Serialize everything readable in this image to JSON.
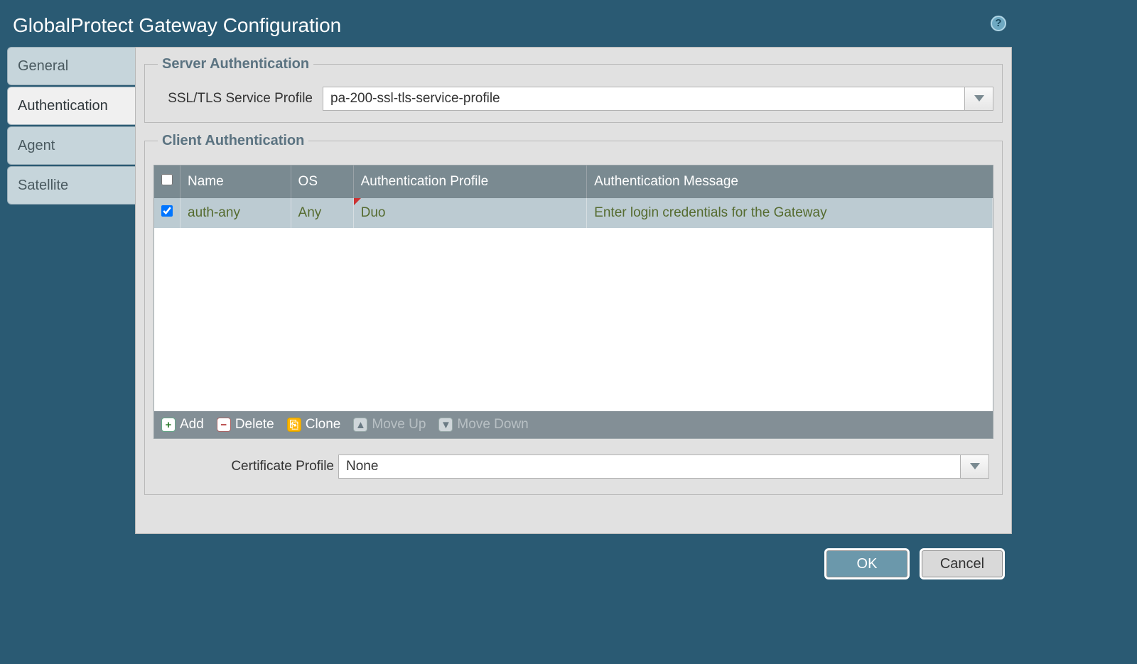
{
  "dialog": {
    "title": "GlobalProtect Gateway Configuration"
  },
  "tabs": {
    "general": "General",
    "authentication": "Authentication",
    "agent": "Agent",
    "satellite": "Satellite"
  },
  "server_auth": {
    "legend": "Server Authentication",
    "ssl_label": "SSL/TLS Service Profile",
    "ssl_value": "pa-200-ssl-tls-service-profile"
  },
  "client_auth": {
    "legend": "Client Authentication",
    "columns": {
      "name": "Name",
      "os": "OS",
      "auth_profile": "Authentication Profile",
      "auth_message": "Authentication Message"
    },
    "rows": [
      {
        "name": "auth-any",
        "os": "Any",
        "auth_profile": "Duo",
        "auth_message": "Enter login credentials for the Gateway"
      }
    ],
    "toolbar": {
      "add": "Add",
      "delete": "Delete",
      "clone": "Clone",
      "move_up": "Move Up",
      "move_down": "Move Down"
    }
  },
  "certificate": {
    "label": "Certificate Profile",
    "value": "None"
  },
  "buttons": {
    "ok": "OK",
    "cancel": "Cancel"
  }
}
